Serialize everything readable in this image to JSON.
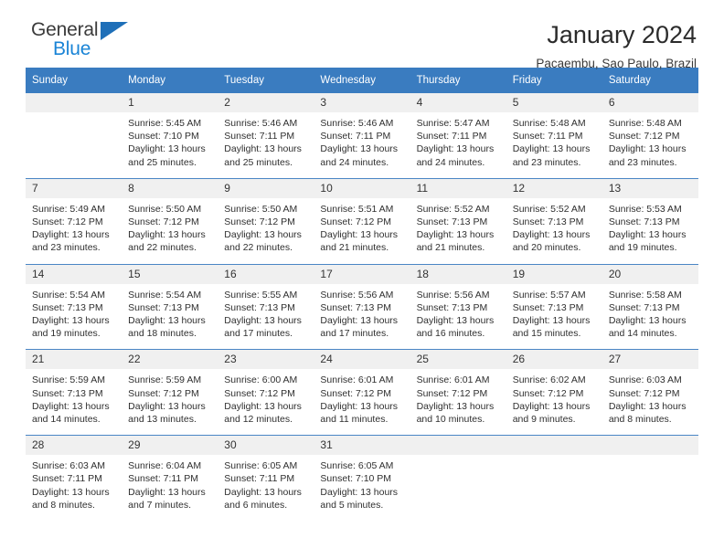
{
  "brand": {
    "line1": "General",
    "line2": "Blue",
    "triangle_color": "#1e6fb8",
    "line2_color": "#1a84d6"
  },
  "header": {
    "title": "January 2024",
    "subtitle": "Pacaembu, Sao Paulo, Brazil"
  },
  "theme": {
    "header_bar": "#3a7cc0",
    "row_divider": "#4a86c5",
    "daynum_band": "#f0f0f0",
    "page_background": "#ffffff"
  },
  "calendar": {
    "weekday_headers": [
      "Sunday",
      "Monday",
      "Tuesday",
      "Wednesday",
      "Thursday",
      "Friday",
      "Saturday"
    ],
    "weeks": [
      [
        {
          "day": "",
          "lines": []
        },
        {
          "day": "1",
          "lines": [
            "Sunrise: 5:45 AM",
            "Sunset: 7:10 PM",
            "Daylight: 13 hours",
            "and 25 minutes."
          ]
        },
        {
          "day": "2",
          "lines": [
            "Sunrise: 5:46 AM",
            "Sunset: 7:11 PM",
            "Daylight: 13 hours",
            "and 25 minutes."
          ]
        },
        {
          "day": "3",
          "lines": [
            "Sunrise: 5:46 AM",
            "Sunset: 7:11 PM",
            "Daylight: 13 hours",
            "and 24 minutes."
          ]
        },
        {
          "day": "4",
          "lines": [
            "Sunrise: 5:47 AM",
            "Sunset: 7:11 PM",
            "Daylight: 13 hours",
            "and 24 minutes."
          ]
        },
        {
          "day": "5",
          "lines": [
            "Sunrise: 5:48 AM",
            "Sunset: 7:11 PM",
            "Daylight: 13 hours",
            "and 23 minutes."
          ]
        },
        {
          "day": "6",
          "lines": [
            "Sunrise: 5:48 AM",
            "Sunset: 7:12 PM",
            "Daylight: 13 hours",
            "and 23 minutes."
          ]
        }
      ],
      [
        {
          "day": "7",
          "lines": [
            "Sunrise: 5:49 AM",
            "Sunset: 7:12 PM",
            "Daylight: 13 hours",
            "and 23 minutes."
          ]
        },
        {
          "day": "8",
          "lines": [
            "Sunrise: 5:50 AM",
            "Sunset: 7:12 PM",
            "Daylight: 13 hours",
            "and 22 minutes."
          ]
        },
        {
          "day": "9",
          "lines": [
            "Sunrise: 5:50 AM",
            "Sunset: 7:12 PM",
            "Daylight: 13 hours",
            "and 22 minutes."
          ]
        },
        {
          "day": "10",
          "lines": [
            "Sunrise: 5:51 AM",
            "Sunset: 7:12 PM",
            "Daylight: 13 hours",
            "and 21 minutes."
          ]
        },
        {
          "day": "11",
          "lines": [
            "Sunrise: 5:52 AM",
            "Sunset: 7:13 PM",
            "Daylight: 13 hours",
            "and 21 minutes."
          ]
        },
        {
          "day": "12",
          "lines": [
            "Sunrise: 5:52 AM",
            "Sunset: 7:13 PM",
            "Daylight: 13 hours",
            "and 20 minutes."
          ]
        },
        {
          "day": "13",
          "lines": [
            "Sunrise: 5:53 AM",
            "Sunset: 7:13 PM",
            "Daylight: 13 hours",
            "and 19 minutes."
          ]
        }
      ],
      [
        {
          "day": "14",
          "lines": [
            "Sunrise: 5:54 AM",
            "Sunset: 7:13 PM",
            "Daylight: 13 hours",
            "and 19 minutes."
          ]
        },
        {
          "day": "15",
          "lines": [
            "Sunrise: 5:54 AM",
            "Sunset: 7:13 PM",
            "Daylight: 13 hours",
            "and 18 minutes."
          ]
        },
        {
          "day": "16",
          "lines": [
            "Sunrise: 5:55 AM",
            "Sunset: 7:13 PM",
            "Daylight: 13 hours",
            "and 17 minutes."
          ]
        },
        {
          "day": "17",
          "lines": [
            "Sunrise: 5:56 AM",
            "Sunset: 7:13 PM",
            "Daylight: 13 hours",
            "and 17 minutes."
          ]
        },
        {
          "day": "18",
          "lines": [
            "Sunrise: 5:56 AM",
            "Sunset: 7:13 PM",
            "Daylight: 13 hours",
            "and 16 minutes."
          ]
        },
        {
          "day": "19",
          "lines": [
            "Sunrise: 5:57 AM",
            "Sunset: 7:13 PM",
            "Daylight: 13 hours",
            "and 15 minutes."
          ]
        },
        {
          "day": "20",
          "lines": [
            "Sunrise: 5:58 AM",
            "Sunset: 7:13 PM",
            "Daylight: 13 hours",
            "and 14 minutes."
          ]
        }
      ],
      [
        {
          "day": "21",
          "lines": [
            "Sunrise: 5:59 AM",
            "Sunset: 7:13 PM",
            "Daylight: 13 hours",
            "and 14 minutes."
          ]
        },
        {
          "day": "22",
          "lines": [
            "Sunrise: 5:59 AM",
            "Sunset: 7:12 PM",
            "Daylight: 13 hours",
            "and 13 minutes."
          ]
        },
        {
          "day": "23",
          "lines": [
            "Sunrise: 6:00 AM",
            "Sunset: 7:12 PM",
            "Daylight: 13 hours",
            "and 12 minutes."
          ]
        },
        {
          "day": "24",
          "lines": [
            "Sunrise: 6:01 AM",
            "Sunset: 7:12 PM",
            "Daylight: 13 hours",
            "and 11 minutes."
          ]
        },
        {
          "day": "25",
          "lines": [
            "Sunrise: 6:01 AM",
            "Sunset: 7:12 PM",
            "Daylight: 13 hours",
            "and 10 minutes."
          ]
        },
        {
          "day": "26",
          "lines": [
            "Sunrise: 6:02 AM",
            "Sunset: 7:12 PM",
            "Daylight: 13 hours",
            "and 9 minutes."
          ]
        },
        {
          "day": "27",
          "lines": [
            "Sunrise: 6:03 AM",
            "Sunset: 7:12 PM",
            "Daylight: 13 hours",
            "and 8 minutes."
          ]
        }
      ],
      [
        {
          "day": "28",
          "lines": [
            "Sunrise: 6:03 AM",
            "Sunset: 7:11 PM",
            "Daylight: 13 hours",
            "and 8 minutes."
          ]
        },
        {
          "day": "29",
          "lines": [
            "Sunrise: 6:04 AM",
            "Sunset: 7:11 PM",
            "Daylight: 13 hours",
            "and 7 minutes."
          ]
        },
        {
          "day": "30",
          "lines": [
            "Sunrise: 6:05 AM",
            "Sunset: 7:11 PM",
            "Daylight: 13 hours",
            "and 6 minutes."
          ]
        },
        {
          "day": "31",
          "lines": [
            "Sunrise: 6:05 AM",
            "Sunset: 7:10 PM",
            "Daylight: 13 hours",
            "and 5 minutes."
          ]
        },
        {
          "day": "",
          "lines": []
        },
        {
          "day": "",
          "lines": []
        },
        {
          "day": "",
          "lines": []
        }
      ]
    ]
  }
}
